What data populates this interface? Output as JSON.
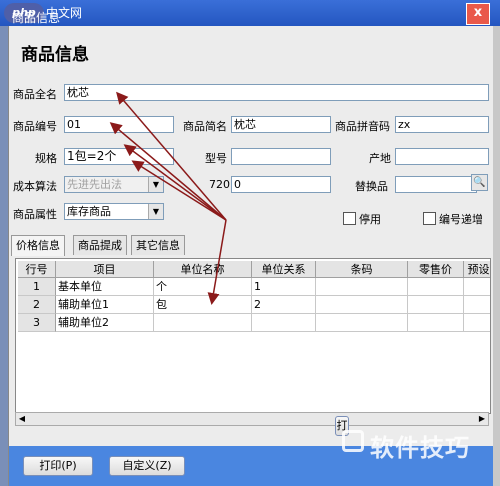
{
  "window": {
    "logo": "php",
    "site": "中文网",
    "title": "商品信息",
    "close": "x"
  },
  "heading": "商品信息",
  "form": {
    "fullname_label": "商品全名",
    "fullname_value": "枕芯",
    "code_label": "商品编号",
    "code_value": "01",
    "shortname_label": "商品简名",
    "shortname_value": "枕芯",
    "pinyin_label": "商品拼音码",
    "pinyin_value": "zx",
    "spec_label": "规格",
    "spec_value": "1包=2个",
    "model_label": "型号",
    "model_value": "",
    "origin_label": "产地",
    "origin_value": "",
    "costing_label": "成本算法",
    "costing_value": "先进先出法",
    "n720_label": "720",
    "n720_value": "0",
    "substitute_label": "替换品",
    "substitute_value": "",
    "attr_label": "商品属性",
    "attr_value": "库存商品",
    "disable_label": "停用",
    "autonum_label": "编号递增"
  },
  "tabs": [
    "价格信息",
    "商品提成",
    "其它信息"
  ],
  "grid": {
    "headers": [
      "行号",
      "项目",
      "单位名称",
      "单位关系",
      "条码",
      "零售价",
      "预设"
    ],
    "rows": [
      {
        "num": "1",
        "item": "基本单位",
        "unit": "个",
        "rel": "1"
      },
      {
        "num": "2",
        "item": "辅助单位1",
        "unit": "包",
        "rel": "2"
      },
      {
        "num": "3",
        "item": "辅助单位2",
        "unit": "",
        "rel": ""
      }
    ]
  },
  "buttons": {
    "print": "打印(P)",
    "custom": "自定义(Z)",
    "side_print": "打"
  },
  "watermark": "软件技巧",
  "colors": {
    "arrow": "#8b1a1a",
    "titlebar": "#2456c0"
  }
}
